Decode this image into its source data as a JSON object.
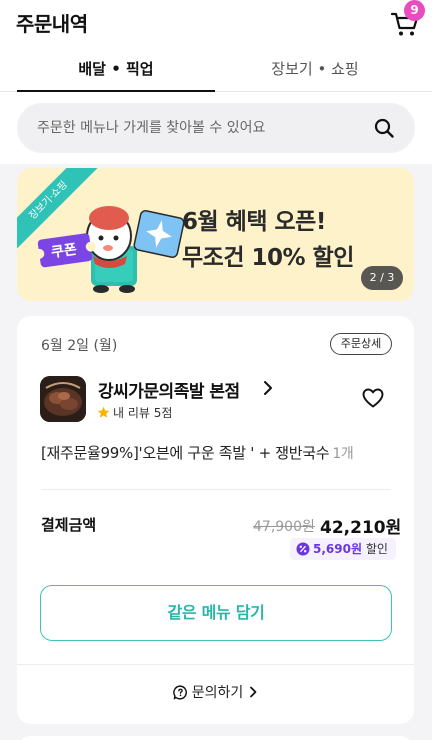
{
  "header": {
    "title": "주문내역",
    "cart_badge": "9"
  },
  "tabs": [
    {
      "label": "배달 • 픽업",
      "active": true
    },
    {
      "label": "장보기 • 쇼핑",
      "active": false
    }
  ],
  "search": {
    "placeholder": "주문한 메뉴나 가게를 찾아볼 수 있어요"
  },
  "banner": {
    "ribbon": "장보기·쇼핑",
    "coupon_label": "쿠폰",
    "line1": "6월 혜택 오픈!",
    "line2": "무조건 10% 할인",
    "page_indicator": "2 / 3"
  },
  "order": {
    "date": "6월 2일 (월)",
    "detail_button": "주문상세",
    "store_name": "강씨가문의족발 본점",
    "review_text": "내 리뷰 5점",
    "menu_text": "[재주문율99%]'오븐에 구운 족발 ' + 쟁반국수",
    "menu_count": "1개",
    "pay_label": "결제금액",
    "original_price": "47,900원",
    "final_price": "42,210원",
    "discount_amount": "5,690원",
    "discount_label": "할인",
    "reorder_button": "같은 메뉴 담기",
    "inquiry_button": "문의하기"
  },
  "colors": {
    "accent": "#2bb5aa",
    "badge": "#e84cc0",
    "discount": "#6a36e0",
    "banner_bg": "#fdf2c9"
  },
  "icons": {
    "cart": "cart-icon",
    "search": "search-icon",
    "store_chevron": "chevron-right-icon",
    "star": "star-icon",
    "heart": "heart-icon",
    "discount": "discount-coin-icon",
    "inquiry": "question-circle-icon",
    "inquiry_chevron": "chevron-right-icon"
  }
}
